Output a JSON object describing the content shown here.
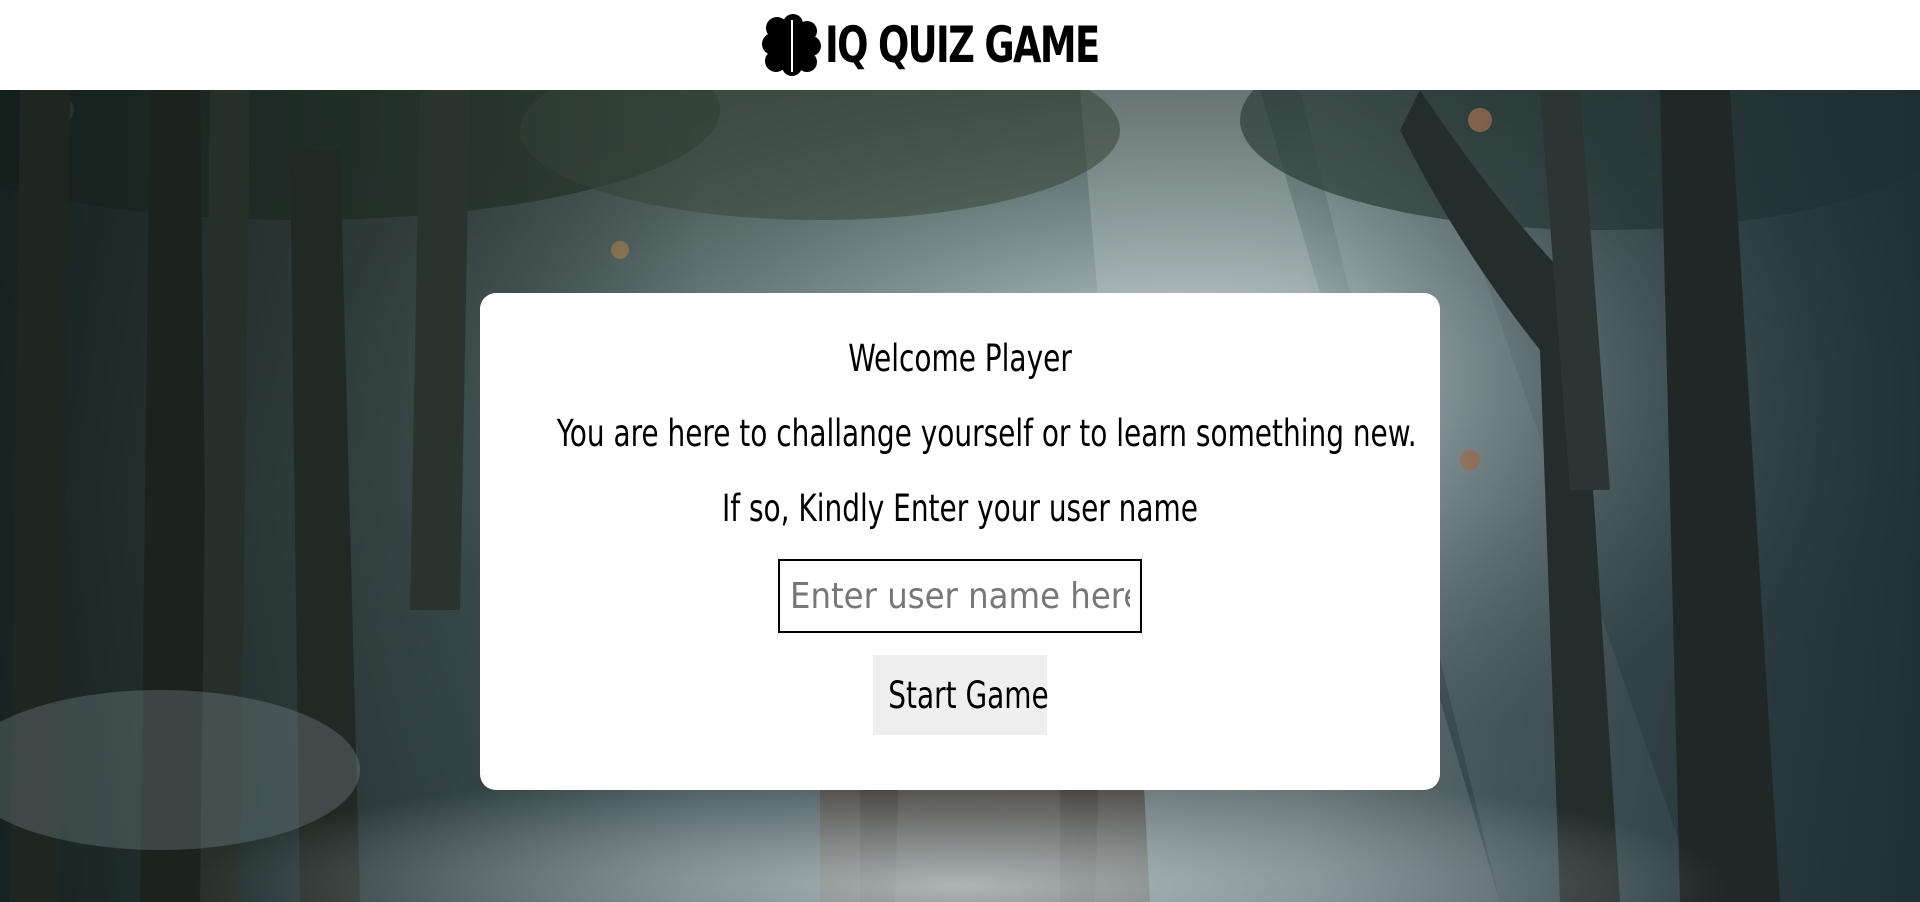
{
  "header": {
    "logo_icon": "brain-icon",
    "title": "IQ QUIZ GAME"
  },
  "background": {
    "image": "misty-forest-with-elephant"
  },
  "welcome_card": {
    "heading": "Welcome Player",
    "intro": "You are here to challange yourself or to learn something new.",
    "prompt": "If so, Kindly Enter your user name",
    "username_input": {
      "value": "",
      "placeholder": "Enter user name here"
    },
    "start_button_label": "Start Game"
  },
  "colors": {
    "header_bg": "#ffffff",
    "card_bg": "#ffffff",
    "button_bg": "#efefef",
    "text": "#000000"
  }
}
